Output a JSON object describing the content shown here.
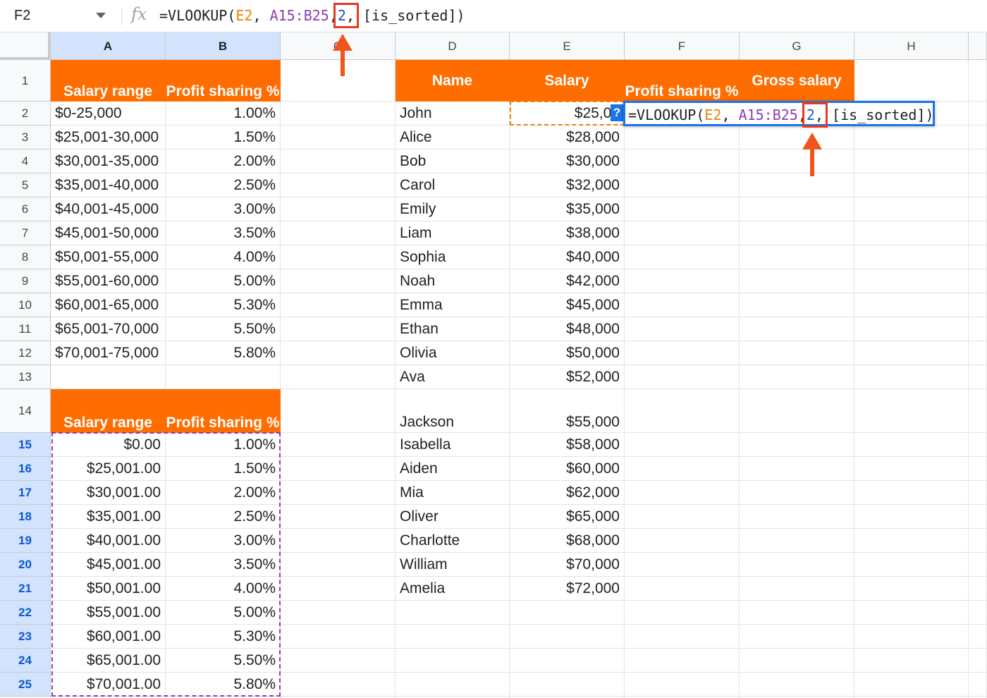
{
  "name_box": "F2",
  "formula": {
    "prefix": "=VLOOKUP(",
    "ref": "E2",
    "sep1": ", ",
    "range": "A15:B25",
    "sep2": ",",
    "index": "2",
    "sep3": ",",
    "rest": " [is_sorted])"
  },
  "col_headers": [
    "A",
    "B",
    "C",
    "D",
    "E",
    "F",
    "G",
    "H"
  ],
  "row_headers": [
    "1",
    "2",
    "3",
    "4",
    "5",
    "6",
    "7",
    "8",
    "9",
    "10",
    "11",
    "12",
    "13",
    "14",
    "15",
    "16",
    "17",
    "18",
    "19",
    "20",
    "21",
    "22",
    "23",
    "24",
    "25"
  ],
  "table1": {
    "header_range": "Salary range",
    "header_pct": "Profit sharing %",
    "rows": [
      [
        "$0-25,000",
        "1.00%"
      ],
      [
        "$25,001-30,000",
        "1.50%"
      ],
      [
        "$30,001-35,000",
        "2.00%"
      ],
      [
        "$35,001-40,000",
        "2.50%"
      ],
      [
        "$40,001-45,000",
        "3.00%"
      ],
      [
        "$45,001-50,000",
        "3.50%"
      ],
      [
        "$50,001-55,000",
        "4.00%"
      ],
      [
        "$55,001-60,000",
        "5.00%"
      ],
      [
        "$60,001-65,000",
        "5.30%"
      ],
      [
        "$65,001-70,000",
        "5.50%"
      ],
      [
        "$70,001-75,000",
        "5.80%"
      ]
    ]
  },
  "table2": {
    "header_range": "Salary range",
    "header_pct": "Profit sharing %",
    "rows": [
      [
        "$0.00",
        "1.00%"
      ],
      [
        "$25,001.00",
        "1.50%"
      ],
      [
        "$30,001.00",
        "2.00%"
      ],
      [
        "$35,001.00",
        "2.50%"
      ],
      [
        "$40,001.00",
        "3.00%"
      ],
      [
        "$45,001.00",
        "3.50%"
      ],
      [
        "$50,001.00",
        "4.00%"
      ],
      [
        "$55,001.00",
        "5.00%"
      ],
      [
        "$60,001.00",
        "5.30%"
      ],
      [
        "$65,001.00",
        "5.50%"
      ],
      [
        "$70,001.00",
        "5.80%"
      ]
    ]
  },
  "employees": {
    "header_name": "Name",
    "header_salary": "Salary",
    "header_profit": "Profit sharing %",
    "header_gross": "Gross salary",
    "rows": [
      [
        "John",
        "$25,00"
      ],
      [
        "Alice",
        "$28,000"
      ],
      [
        "Bob",
        "$30,000"
      ],
      [
        "Carol",
        "$32,000"
      ],
      [
        "Emily",
        "$35,000"
      ],
      [
        "Liam",
        "$38,000"
      ],
      [
        "Sophia",
        "$40,000"
      ],
      [
        "Noah",
        "$42,000"
      ],
      [
        "Emma",
        "$45,000"
      ],
      [
        "Ethan",
        "$48,000"
      ],
      [
        "Olivia",
        "$50,000"
      ],
      [
        "Ava",
        "$52,000"
      ],
      [
        "Jackson",
        "$55,000"
      ],
      [
        "Isabella",
        "$58,000"
      ],
      [
        "Aiden",
        "$60,000"
      ],
      [
        "Mia",
        "$62,000"
      ],
      [
        "Oliver",
        "$65,000"
      ],
      [
        "Charlotte",
        "$68,000"
      ],
      [
        "William",
        "$70,000"
      ],
      [
        "Amelia",
        "$72,000"
      ]
    ]
  },
  "help_badge": "?",
  "colors": {
    "header_orange": "#ff6d01",
    "range_purple": "#8f3bb5",
    "ref_orange": "#e8830c",
    "index_blue": "#1a53c4",
    "highlight_red": "#e53a1d",
    "arrow_orange": "#f0561c",
    "editor_blue": "#1a73e8"
  }
}
